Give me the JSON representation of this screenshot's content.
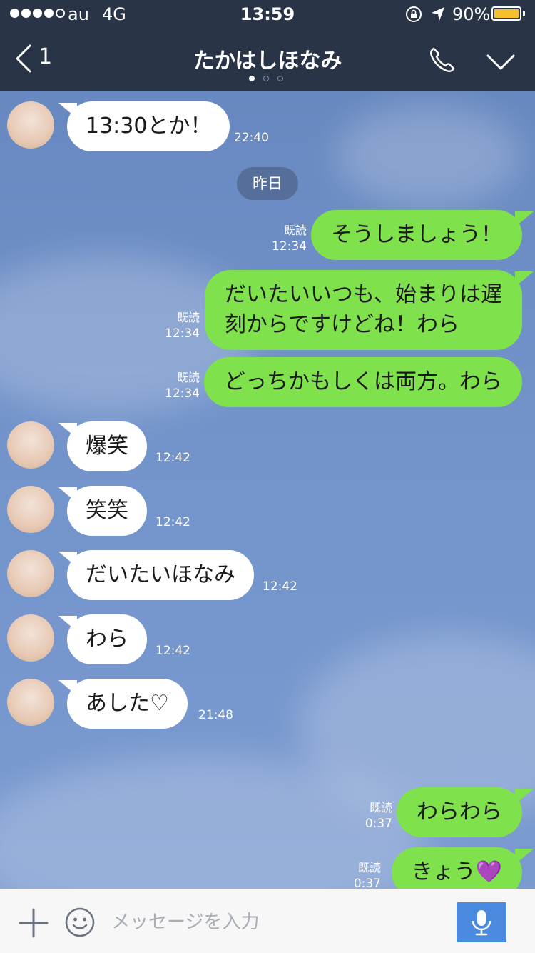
{
  "status_bar": {
    "carrier": "au",
    "network": "4G",
    "time": "13:59",
    "battery": "90%"
  },
  "header": {
    "back_count": "1",
    "title": "たかはしほなみ"
  },
  "divider": {
    "label": "昨日"
  },
  "read_label": "既読",
  "messages": [
    {
      "from": "them",
      "text": "13:30とか！",
      "time": "22:40"
    },
    {
      "from": "me",
      "text": "そうしましょう！",
      "time": "12:34"
    },
    {
      "from": "me",
      "line1": "だいたいいつも、始まりは遅",
      "line2": "刻からですけどね！わら",
      "time": "12:34"
    },
    {
      "from": "me",
      "text": "どっちかもしくは両方。わら",
      "time": "12:34"
    },
    {
      "from": "them",
      "text": "爆笑",
      "time": "12:42"
    },
    {
      "from": "them",
      "text": "笑笑",
      "time": "12:42"
    },
    {
      "from": "them",
      "text": "だいたいほなみ",
      "time": "12:42"
    },
    {
      "from": "them",
      "text": "わら",
      "time": "12:42"
    },
    {
      "from": "them",
      "text": "あした♡",
      "time": "21:48"
    },
    {
      "from": "me",
      "text": "わらわら",
      "time": "0:37"
    },
    {
      "from": "me",
      "text": "きょう💜",
      "time": "0:37"
    }
  ],
  "input": {
    "placeholder": "メッセージを入力",
    "value": ""
  },
  "colors": {
    "header_bg": "#2a3447",
    "my_bubble": "#7fe14c",
    "their_bubble": "#ffffff",
    "mic_button": "#4a8be0"
  }
}
